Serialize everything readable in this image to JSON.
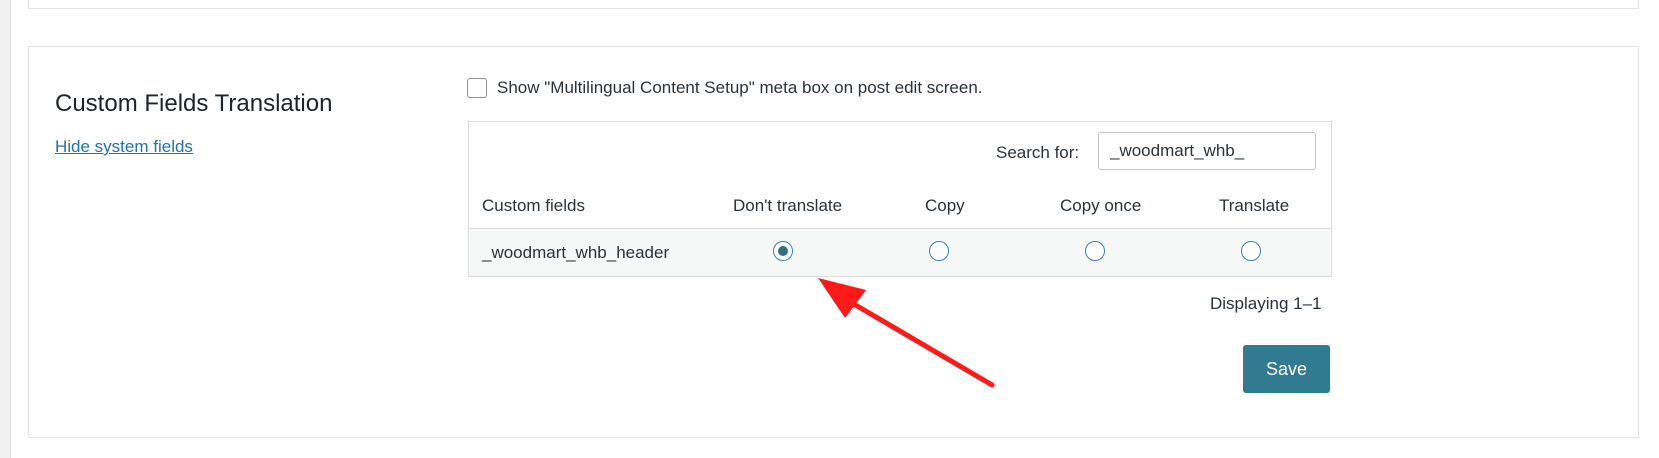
{
  "section": {
    "title": "Custom Fields Translation",
    "hide_link": "Hide system fields"
  },
  "meta_box": {
    "label": "Show \"Multilingual Content Setup\" meta box on post edit screen.",
    "checked": false
  },
  "search": {
    "label": "Search for:",
    "value": "_woodmart_whb_"
  },
  "table": {
    "headers": [
      "Custom fields",
      "Don't translate",
      "Copy",
      "Copy once",
      "Translate"
    ],
    "rows": [
      {
        "name": "_woodmart_whb_header",
        "selected": "Don't translate"
      }
    ]
  },
  "pagination": {
    "text": "Displaying 1–1"
  },
  "save_label": "Save",
  "colors": {
    "accent": "#317b90",
    "link": "#2271b1",
    "annotation_arrow": "#ff1a1a"
  }
}
